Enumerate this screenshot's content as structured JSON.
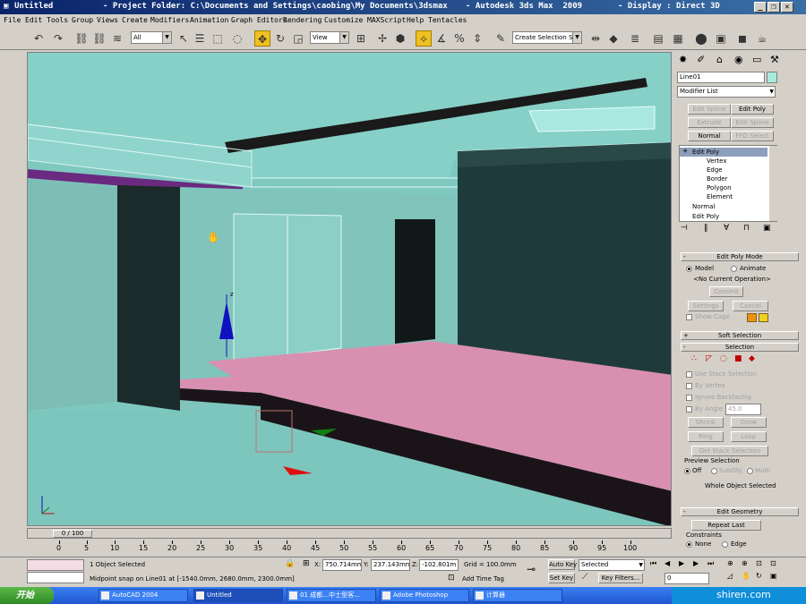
{
  "window": {
    "title_left": "Untitled",
    "title_project": "- Project Folder: C:\\Documents and Settings\\caobing\\My Documents\\3dsmax",
    "title_app": "- Autodesk 3ds Max  2009",
    "title_display": "- Display : Direct 3D"
  },
  "menu": [
    "File",
    "Edit",
    "Tools",
    "Group",
    "Views",
    "Create",
    "Modifiers",
    "Animation",
    "Graph Editors",
    "Rendering",
    "Customize",
    "MAXScript",
    "Help",
    "Tentacles"
  ],
  "toolbar": {
    "selection_filter": "All",
    "reference_coord": "View",
    "named_selection": "Create Selection Set"
  },
  "command_panel": {
    "object_name": "Line01",
    "modifier_list": "Modifier List",
    "modifier_buttons": [
      "Edit Spline",
      "Edit Poly",
      "Extrude",
      "Edit Spline",
      "Normal",
      "FFD Select"
    ],
    "stack": {
      "top": "Edit Poly",
      "subobjects": [
        "Vertex",
        "Edge",
        "Border",
        "Polygon",
        "Element"
      ],
      "rest": [
        "Normal",
        "Edit Poly"
      ]
    },
    "edit_poly_mode": {
      "title": "Edit Poly Mode",
      "model": "Model",
      "animate": "Animate",
      "operation": "<No Current Operation>",
      "commit": "Commit",
      "settings": "Settings",
      "cancel": "Cancel",
      "show_cage": "Show Cage"
    },
    "soft_selection": "Soft Selection",
    "selection": {
      "title": "Selection",
      "use_stack": "Use Stack Selection",
      "by_vertex": "By Vertex",
      "ignore_backfacing": "Ignore Backfacing",
      "by_angle": "By Angle:",
      "angle_value": "45.0",
      "shrink": "Shrink",
      "grow": "Grow",
      "ring": "Ring",
      "loop": "Loop",
      "get_stack": "Get Stack Selection",
      "preview_title": "Preview Selection",
      "off": "Off",
      "subobj": "SubObj",
      "multi": "Multi",
      "whole_object": "Whole Object Selected"
    },
    "edit_geometry": {
      "title": "Edit Geometry",
      "repeat_last": "Repeat Last",
      "constraints": "Constraints",
      "none": "None",
      "edge": "Edge"
    }
  },
  "timeline": {
    "frame": "0 / 100",
    "ticks": [
      "0",
      "5",
      "10",
      "15",
      "20",
      "25",
      "30",
      "35",
      "40",
      "45",
      "50",
      "55",
      "60",
      "65",
      "70",
      "75",
      "80",
      "85",
      "90",
      "95",
      "100"
    ]
  },
  "status": {
    "selected": "1 Object Selected",
    "prompt": "Midpoint snap on Line01 at [-1540.0mm, 2680.0mm, 2300.0mm]",
    "x": "750.714mm",
    "y": "237.143mm",
    "z": "-102.801m",
    "grid": "Grid = 100.0mm",
    "add_time_tag": "Add Time Tag",
    "auto_key": "Auto Key",
    "set_key": "Set Key",
    "selected_dropdown": "Selected",
    "key_filters": "Key Filters...",
    "frame_field": "0"
  },
  "taskbar": {
    "start": "开始",
    "tasks": [
      "AutoCAD 2004",
      "Untitled",
      "01 成都…中士型客…",
      "Adobe Photoshop",
      "计算器"
    ],
    "watermark": "shiren.com"
  }
}
